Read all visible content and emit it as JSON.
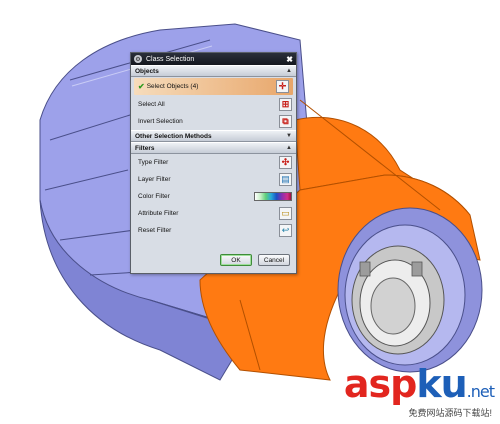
{
  "dialog": {
    "title": "Class Selection",
    "close_glyph": "✖",
    "sections": {
      "objects": {
        "label": "Objects",
        "items": [
          {
            "label": "Select Objects (4)",
            "icon": "select-objects-icon",
            "selected": true
          },
          {
            "label": "Select All",
            "icon": "select-all-icon"
          },
          {
            "label": "Invert Selection",
            "icon": "invert-selection-icon"
          }
        ]
      },
      "other_methods": {
        "label": "Other Selection Methods"
      },
      "filters": {
        "label": "Filters",
        "items": [
          {
            "label": "Type Filter",
            "icon": "type-filter-icon"
          },
          {
            "label": "Layer Filter",
            "icon": "layer-filter-icon"
          },
          {
            "label": "Color Filter",
            "icon": "color-bar"
          },
          {
            "label": "Attribute Filter",
            "icon": "attribute-filter-icon"
          },
          {
            "label": "Reset Filter",
            "icon": "reset-filter-icon"
          }
        ]
      }
    },
    "ok_label": "OK",
    "cancel_label": "Cancel"
  },
  "watermark": {
    "brand_asp": "asp",
    "brand_ku": "ku",
    "brand_net": ".net",
    "tagline": "免费网站源码下载站!"
  },
  "colors": {
    "part_body": "#9a9ee8",
    "highlight": "#ff7a12",
    "titlebar": "#1c2029",
    "dialog_bg": "#d8dde5"
  }
}
